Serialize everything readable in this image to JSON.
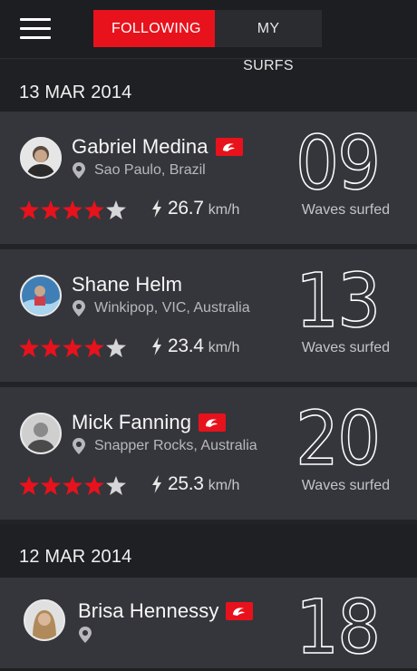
{
  "tabs": {
    "following": "FOLLOWING",
    "my_surfs": "MY SURFS"
  },
  "groups": [
    {
      "date": "13 MAR 2014",
      "sessions": [
        {
          "name": "Gabriel Medina",
          "location": "Sao Paulo, Brazil",
          "rating": 4,
          "speed": "26.7",
          "speed_unit": "km/h",
          "waves": "09",
          "waves_label": "Waves surfed"
        },
        {
          "name": "Shane Helm",
          "location": "Winkipop, VIC, Australia",
          "rating": 4,
          "speed": "23.4",
          "speed_unit": "km/h",
          "waves": "13",
          "waves_label": "Waves surfed"
        },
        {
          "name": "Mick Fanning",
          "location": "Snapper Rocks, Australia",
          "rating": 4,
          "speed": "25.3",
          "speed_unit": "km/h",
          "waves": "20",
          "waves_label": "Waves surfed"
        }
      ]
    },
    {
      "date": "12 MAR 2014",
      "sessions": [
        {
          "name": "Brisa Hennessy",
          "location": "",
          "waves": "18"
        }
      ]
    }
  ],
  "icons": {
    "menu": "hamburger-menu-icon",
    "pin": "location-pin-icon",
    "bolt": "lightning-bolt-icon",
    "star": "star-icon",
    "badge": "ripcurl-badge-icon"
  },
  "colors": {
    "accent": "#e8121c",
    "card": "#35363b",
    "background": "#1f2023"
  }
}
